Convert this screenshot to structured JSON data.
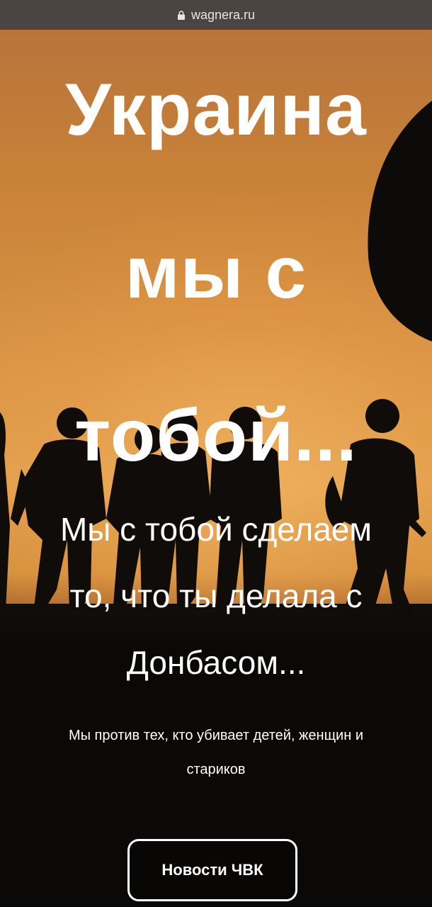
{
  "browser": {
    "url": "wagnera.ru"
  },
  "hero": {
    "headline_lines": [
      "Украина",
      "мы с",
      "тобой..."
    ],
    "subline_lines": [
      "Мы с тобой сделаем",
      "то, что ты делала с",
      "Донбасом..."
    ],
    "note_lines": [
      "Мы против тех, кто убивает детей, женщин и",
      "стариков"
    ]
  },
  "buttons": {
    "news_label": "Новости ЧВК"
  },
  "colors": {
    "sky_top": "#b8743a",
    "sky_glow": "#e0a04e",
    "ground": "#0b0908",
    "text": "#ffffff",
    "urlbar": "#4a4540"
  }
}
